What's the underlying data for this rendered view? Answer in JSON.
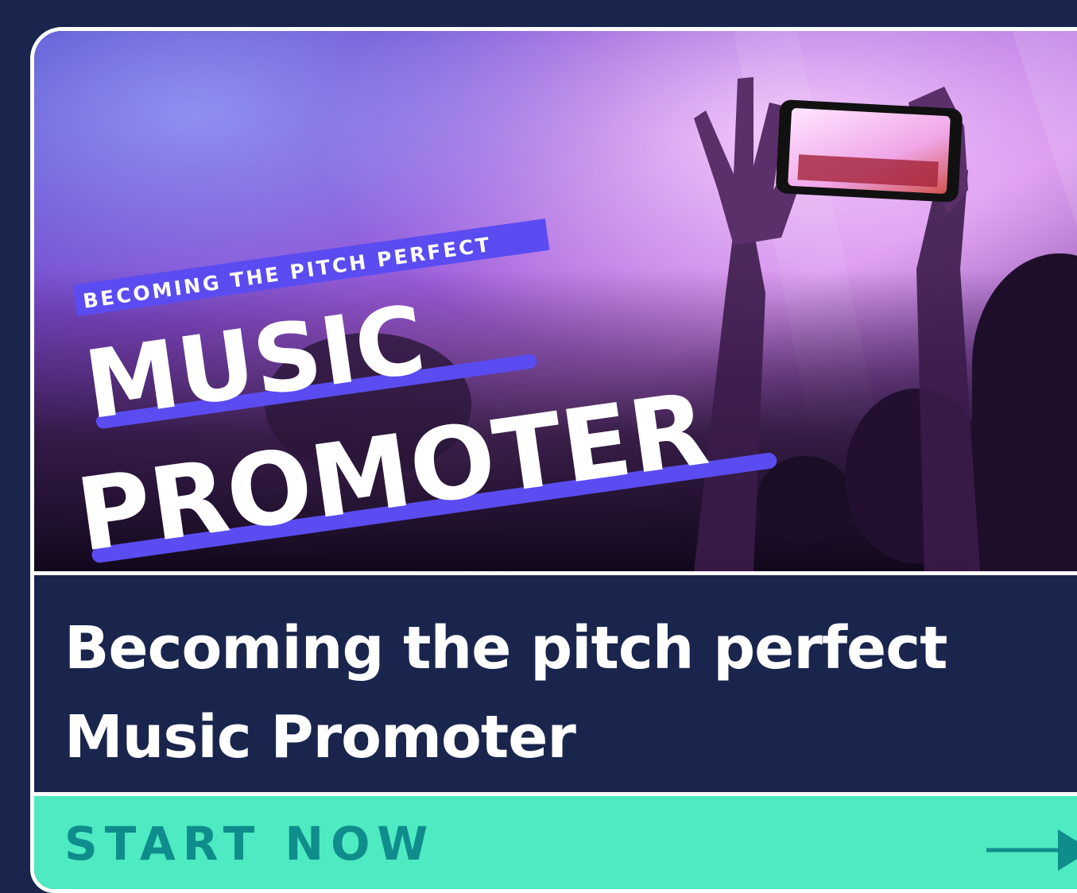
{
  "hero": {
    "kicker": "BECOMING THE PITCH PERFECT",
    "headline_line1": "MUSIC",
    "headline_line2": "PROMOTER"
  },
  "card": {
    "title": "Becoming the pitch perfect Music Promoter"
  },
  "cta": {
    "label": "START NOW",
    "icon": "arrow-right-icon"
  },
  "colors": {
    "page_background": "#1a254d",
    "card_border": "#ffffff",
    "title_panel": "#1a254d",
    "title_text": "#ffffff",
    "cta_background": "#4eeac2",
    "cta_text": "#0f8c8c",
    "accent_underline": "#5a4cf0"
  }
}
